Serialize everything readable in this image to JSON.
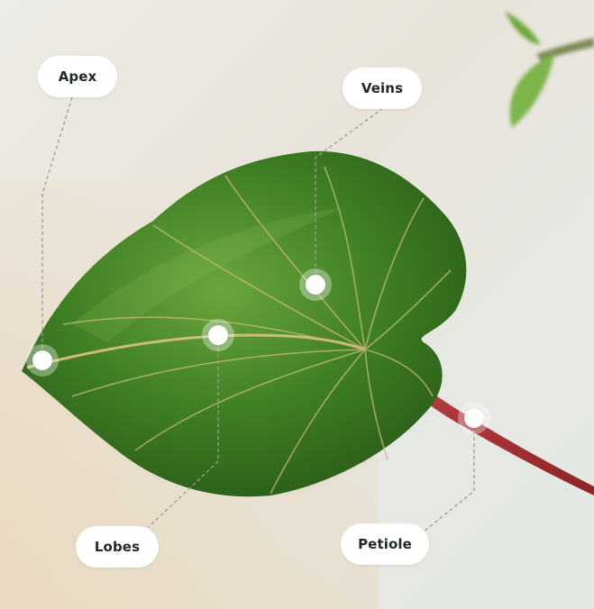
{
  "labels": {
    "apex": "Apex",
    "veins": "Veins",
    "lobes": "Lobes",
    "petiole": "Petiole"
  },
  "colors": {
    "leaf_dark": "#2f6a1f",
    "leaf_mid": "#4c8f2c",
    "leaf_light": "#79b04a",
    "midrib": "#e3c48a",
    "petiole": "#b8343a",
    "leader_line": "#9c9c98"
  }
}
